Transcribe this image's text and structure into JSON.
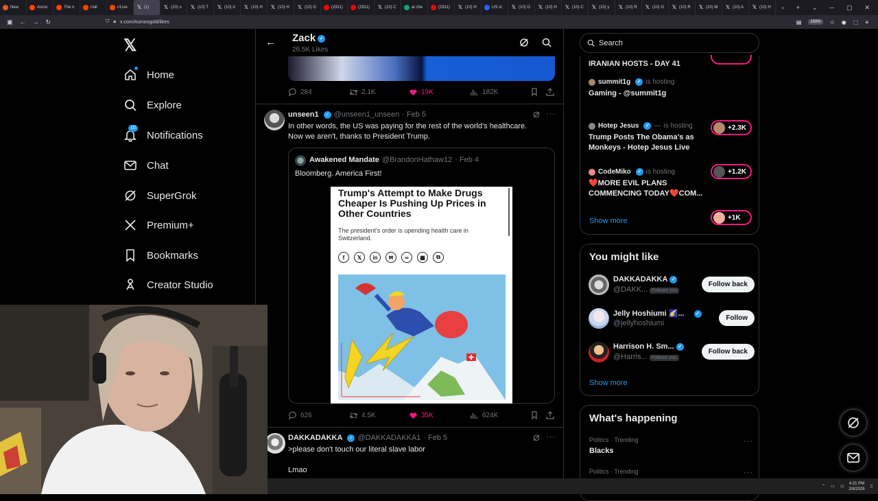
{
  "browser": {
    "tabs": [
      {
        "label": "New",
        "fav": "#e05a2b"
      },
      {
        "label": "Asmo",
        "fav": "#ff4500"
      },
      {
        "label": "The n",
        "fav": "#ff4500"
      },
      {
        "label": "r/all",
        "fav": "#ff4500"
      },
      {
        "label": "r/Live",
        "fav": "#ff4500"
      },
      {
        "label": "(1)",
        "fav": "x",
        "active": true
      },
      {
        "label": "(10) o",
        "fav": "x"
      },
      {
        "label": "(10) T",
        "fav": "x"
      },
      {
        "label": "(10) d",
        "fav": "x"
      },
      {
        "label": "(10) H",
        "fav": "x"
      },
      {
        "label": "(10) H",
        "fav": "x"
      },
      {
        "label": "(10) G",
        "fav": "x"
      },
      {
        "label": "(2911)",
        "fav": "#ff0000"
      },
      {
        "label": "(2911)",
        "fav": "#ff0000"
      },
      {
        "label": "(10) C",
        "fav": "x"
      },
      {
        "label": "ai che",
        "fav": "#10a37f"
      },
      {
        "label": "(2911)",
        "fav": "#ff0000"
      },
      {
        "label": "(10) H",
        "fav": "x"
      },
      {
        "label": "US st",
        "fav": "#2962ff"
      },
      {
        "label": "(10) G",
        "fav": "x"
      },
      {
        "label": "(10) H",
        "fav": "x"
      },
      {
        "label": "(10) C",
        "fav": "x"
      },
      {
        "label": "(10) y",
        "fav": "x"
      },
      {
        "label": "(10) R",
        "fav": "x"
      },
      {
        "label": "(10) G",
        "fav": "x"
      },
      {
        "label": "(10) R",
        "fav": "x"
      },
      {
        "label": "(10) M",
        "fav": "x"
      },
      {
        "label": "(10) A",
        "fav": "x"
      },
      {
        "label": "(10) H",
        "fav": "x"
      }
    ],
    "url": "x.com/Asmongold/likes",
    "zoom": "150%"
  },
  "nav": {
    "items": [
      {
        "label": "Home",
        "icon": "home-icon"
      },
      {
        "label": "Explore",
        "icon": "search-icon"
      },
      {
        "label": "Notifications",
        "icon": "bell-icon",
        "badge": "10"
      },
      {
        "label": "Chat",
        "icon": "mail-icon"
      },
      {
        "label": "SuperGrok",
        "icon": "grok-icon"
      },
      {
        "label": "Premium+",
        "icon": "x-logo-icon"
      },
      {
        "label": "Bookmarks",
        "icon": "bookmark-icon"
      },
      {
        "label": "Creator Studio",
        "icon": "creator-icon"
      }
    ]
  },
  "header": {
    "name": "Zack",
    "likes": "26.5K Likes"
  },
  "top_tweet": {
    "replies": "284",
    "reposts": "2.1K",
    "likes": "19K",
    "views": "182K"
  },
  "tweet1": {
    "name": "unseen1",
    "handle": "@unseen1_unseen",
    "date": "· Feb 5",
    "text1": "In other words,  the US was paying for the rest of the world's healthcare.",
    "text2": "Now we aren't, thanks to President Trump.",
    "quote": {
      "name": "Awakened Mandate",
      "handle": "@BrandonHathaw12",
      "date": "· Feb 4",
      "text": "Bloomberg. America First!",
      "headline": "Trump's Attempt to Make Drugs Cheaper Is Pushing Up Prices in Other Countries",
      "subhead": "The president's order is upending health care in Switzerland."
    },
    "replies": "626",
    "reposts": "4.5K",
    "likes": "35K",
    "views": "624K"
  },
  "tweet2": {
    "name": "DAKKADAKKA",
    "handle": "@DAKKADAKKA1",
    "date": "· Feb 5",
    "text1": ">please don't touch our literal slave labor",
    "text2": "Lmao"
  },
  "search": {
    "placeholder": "Search"
  },
  "spaces": [
    {
      "host": "",
      "title": "IRANIAN HOSTS - DAY 41",
      "count": ""
    },
    {
      "host": "summit1g",
      "is": "is hosting",
      "title": "Gaming - @summit1g",
      "count": "+2.3K"
    },
    {
      "host": "Hotep Jesus",
      "is": "is hosting",
      "title": "Trump Posts The Obama's as Monkeys - Hotep Jesus Live",
      "count": "+1.2K"
    },
    {
      "host": "CodeMiko",
      "is": "is hosting",
      "title": "❤️MORE EVIL PLANS COMMENCING TODAY❤️COM...",
      "count": "+1K"
    }
  ],
  "show_more": "Show more",
  "you_might_like": {
    "title": "You might like",
    "users": [
      {
        "name": "DAKKADAKKA",
        "handle": "@DAKK...",
        "follows_you": "Follows you",
        "button": "Follow back"
      },
      {
        "name": "Jelly Hoshiumi 🌠...",
        "handle": "@jellyhoshiumi",
        "follows_you": "",
        "button": "Follow"
      },
      {
        "name": "Harrison H. Sm...",
        "handle": "@Harris...",
        "follows_you": "Follows you",
        "button": "Follow back"
      }
    ]
  },
  "happening": {
    "title": "What's happening",
    "trends": [
      {
        "context": "Politics · Trending",
        "name": "Blacks"
      },
      {
        "context": "Politics · Trending",
        "name": ""
      }
    ]
  },
  "taskbar": {
    "time": "4:21 PM",
    "date": "2/6/2026"
  },
  "colors": {
    "accent": "#1d9bf0",
    "like": "#f91880",
    "border": "#2f3336",
    "muted": "#71767b"
  }
}
